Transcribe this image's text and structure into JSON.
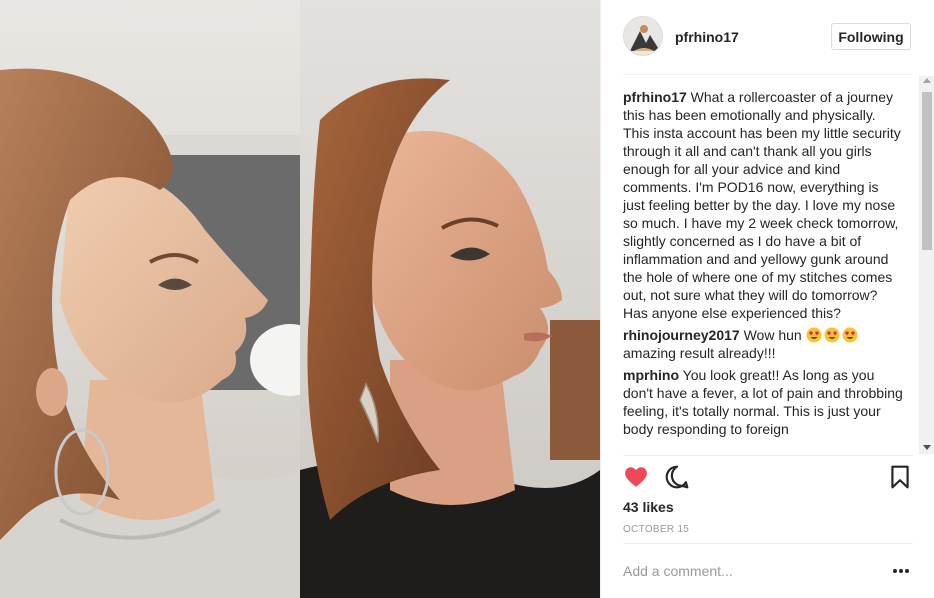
{
  "post": {
    "photos": [
      {
        "name": "left-profile-photo"
      },
      {
        "name": "right-profile-photo"
      }
    ]
  },
  "header": {
    "username": "pfrhino17",
    "follow_label": "Following"
  },
  "comments": [
    {
      "author": "pfrhino17",
      "text": "What a rollercoaster of a journey this has been emotionally and physically. This insta account has been my little security through it all and can't thank all you girls enough for all your advice and kind comments. I'm POD16 now, everything is just feeling better by the day. I love my nose so much. I have my 2 week check tomorrow, slightly concerned as I do have a bit of inflammation and and yellowy gunk around the hole of where one of my stitches comes out, not sure what they will do tomorrow? Has anyone else experienced this?"
    },
    {
      "author": "rhinojourney2017",
      "text_before": "Wow hun",
      "emoji": [
        "heart-eyes-emoji",
        "heart-eyes-emoji",
        "heart-eyes-emoji"
      ],
      "text_after": "amazing result already!!!"
    },
    {
      "author": "mprhino",
      "text": "You look great!! As long as you don't have a fever, a lot of pain and throbbing feeling, it's totally normal. This is just your body responding to foreign"
    }
  ],
  "actions": {
    "like_icon": "heart-filled-icon",
    "comment_icon": "comment-bubble-icon",
    "save_icon": "bookmark-icon",
    "like_color": "#ed4956"
  },
  "likes": "43 likes",
  "date": "OCTOBER 15",
  "add_comment": {
    "placeholder": "Add a comment..."
  },
  "colors": {
    "text": "#262626",
    "muted": "#999999",
    "border": "#efefef"
  }
}
